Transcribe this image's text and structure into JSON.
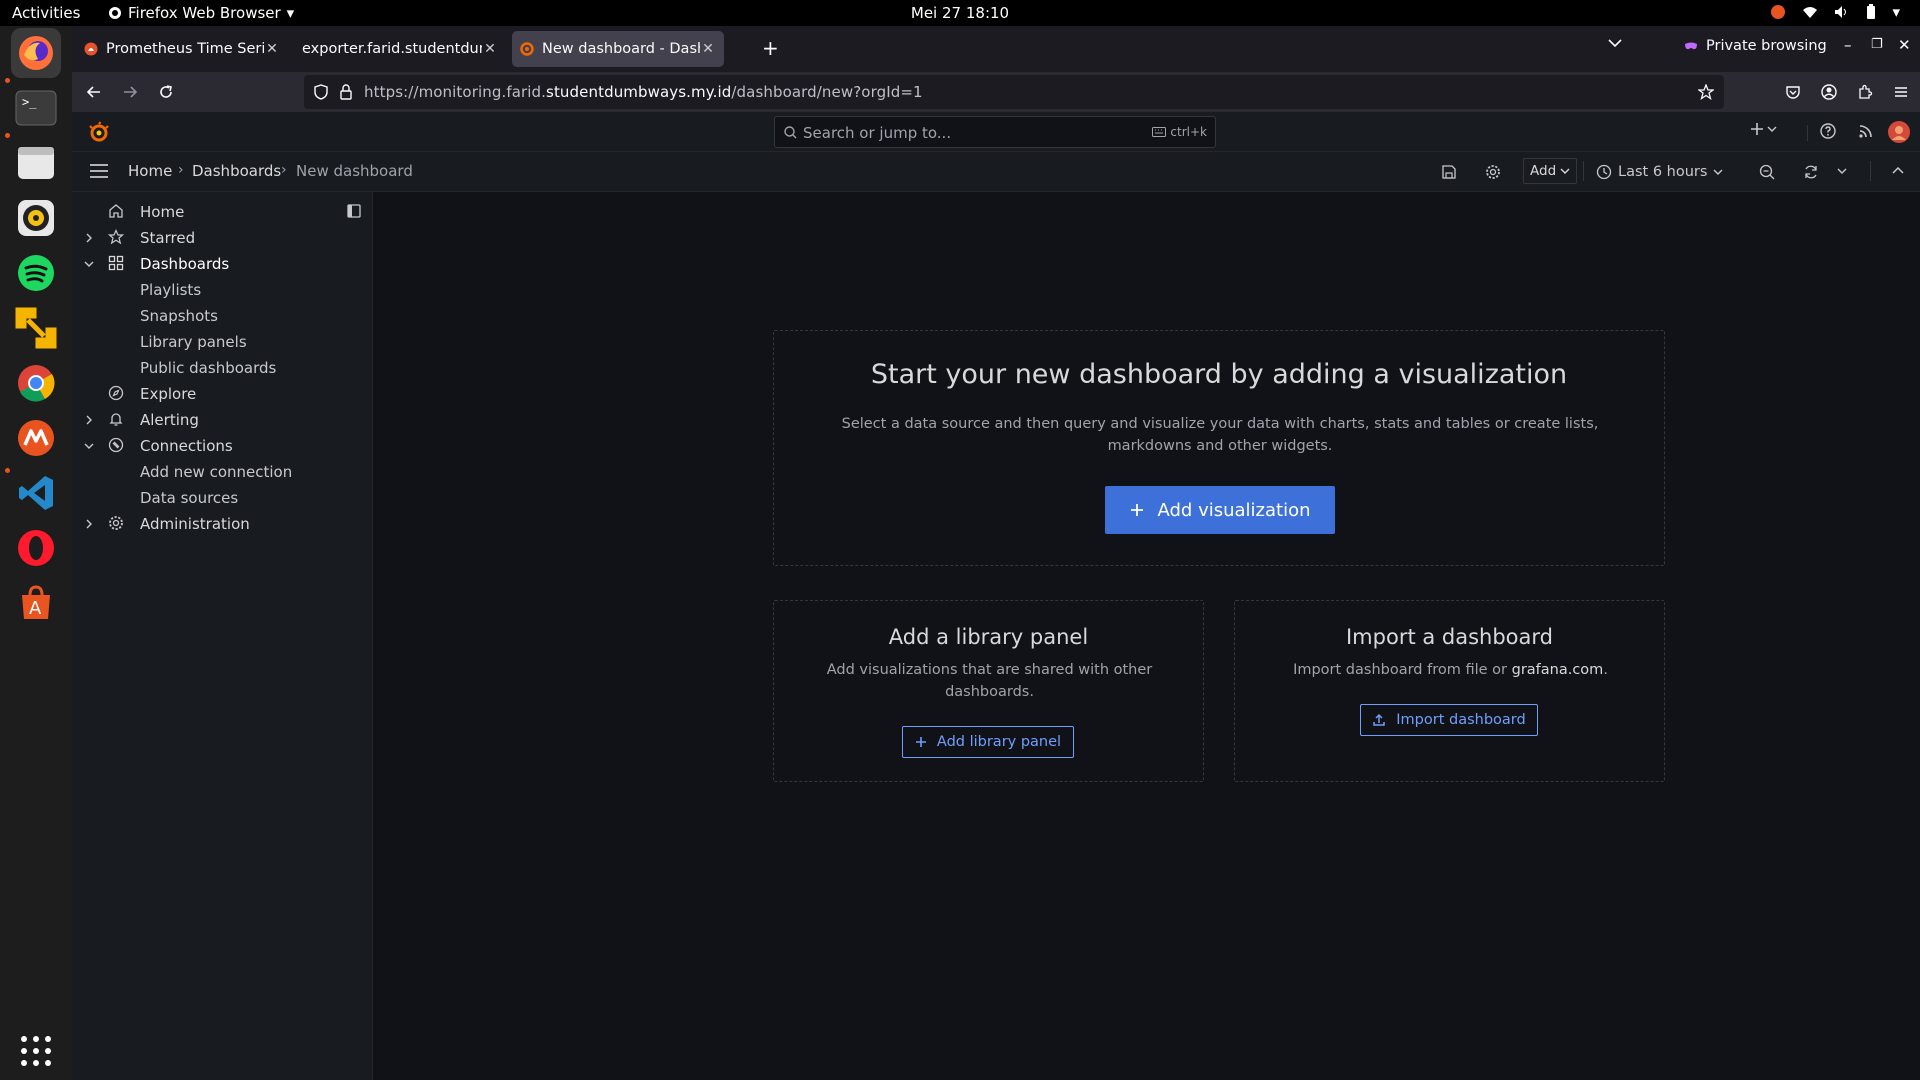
{
  "os": {
    "activities": "Activities",
    "app_menu": "Firefox Web Browser",
    "clock": "Mei 27  18:10"
  },
  "browser": {
    "tabs": [
      {
        "title": "Prometheus Time Series",
        "active": false
      },
      {
        "title": "exporter.farid.studentdumbways.my.id",
        "active": false
      },
      {
        "title": "New dashboard - Dashboards",
        "active": true
      }
    ],
    "private_label": "Private browsing",
    "url_prefix": "https://monitoring.farid.",
    "url_domain": "studentdumbways.my.id",
    "url_suffix": "/dashboard/new?orgId=1"
  },
  "grafana": {
    "search_placeholder": "Search or jump to...",
    "search_shortcut": "ctrl+k",
    "breadcrumb": [
      "Home",
      "Dashboards",
      "New dashboard"
    ],
    "toolbar": {
      "add_label": "Add",
      "time_range": "Last 6 hours"
    },
    "sidebar": {
      "items": [
        {
          "label": "Home"
        },
        {
          "label": "Starred"
        },
        {
          "label": "Dashboards"
        },
        {
          "label": "Playlists"
        },
        {
          "label": "Snapshots"
        },
        {
          "label": "Library panels"
        },
        {
          "label": "Public dashboards"
        },
        {
          "label": "Explore"
        },
        {
          "label": "Alerting"
        },
        {
          "label": "Connections"
        },
        {
          "label": "Add new connection"
        },
        {
          "label": "Data sources"
        },
        {
          "label": "Administration"
        }
      ]
    },
    "empty_state": {
      "title": "Start your new dashboard by adding a visualization",
      "description_line1": "Select a data source and then query and visualize your data with charts, stats and tables or create lists,",
      "description_line2": "markdowns and other widgets.",
      "add_viz_label": "Add visualization"
    },
    "library_panel": {
      "title": "Add a library panel",
      "description_line1": "Add visualizations that are shared with other",
      "description_line2": "dashboards.",
      "button": "Add library panel"
    },
    "import_panel": {
      "title": "Import a dashboard",
      "description_prefix": "Import dashboard from file or ",
      "description_link": "grafana.com",
      "description_suffix": ".",
      "button": "Import dashboard"
    }
  },
  "colors": {
    "accent": "#3d71d9",
    "link": "#6e9fff",
    "bg": "#111217",
    "panel": "#181b1f"
  }
}
